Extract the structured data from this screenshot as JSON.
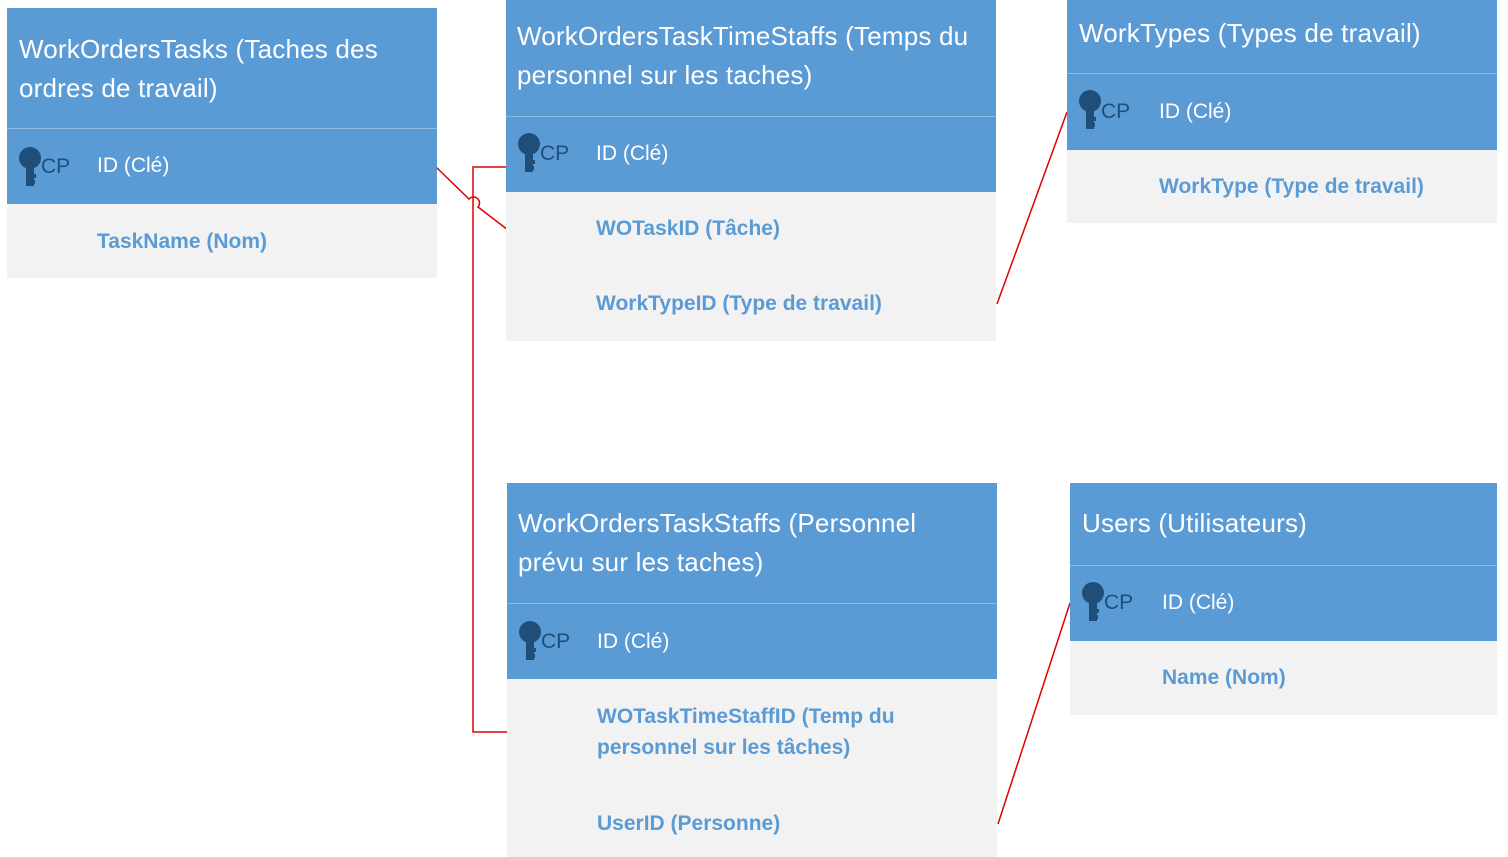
{
  "diagram": {
    "pk_tag": "CP",
    "entities": {
      "work_orders_tasks": {
        "title": "WorkOrdersTasks (Taches des ordres de travail)",
        "pk": "ID (Clé)",
        "fields": [
          "TaskName (Nom)"
        ]
      },
      "work_orders_task_time_staffs": {
        "title": "WorkOrdersTaskTimeStaffs (Temps du personnel sur les taches)",
        "pk": "ID (Clé)",
        "fields": [
          "WOTaskID (Tâche)",
          "WorkTypeID (Type de travail)"
        ]
      },
      "work_types": {
        "title": "WorkTypes (Types de travail)",
        "pk": "ID (Clé)",
        "fields": [
          "WorkType (Type de travail)"
        ]
      },
      "work_orders_task_staffs": {
        "title": "WorkOrdersTaskStaffs (Personnel prévu sur les taches)",
        "pk": "ID (Clé)",
        "fields": [
          "WOTaskTimeStaffID (Temp du personnel sur les tâches)",
          "UserID (Personne)"
        ]
      },
      "users": {
        "title": "Users (Utilisateurs)",
        "pk": "ID (Clé)",
        "fields": [
          "Name (Nom)"
        ]
      }
    },
    "colors": {
      "header": "#5b9bd5",
      "body": "#f2f2f2",
      "field_text": "#5b9bd5",
      "key_icon": "#1f4e79",
      "relationship_line": "#e00000"
    }
  }
}
